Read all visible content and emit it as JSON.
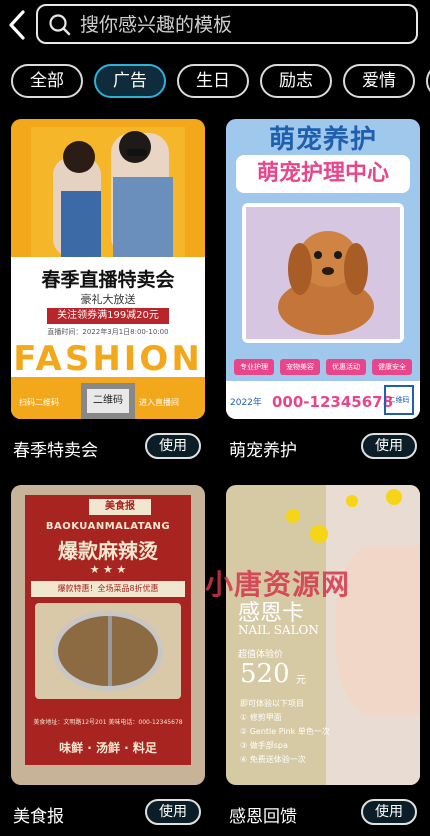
{
  "search": {
    "placeholder": "搜你感兴趣的模板"
  },
  "categories": [
    {
      "label": "全部"
    },
    {
      "label": "广告",
      "active": true
    },
    {
      "label": "生日"
    },
    {
      "label": "励志"
    },
    {
      "label": "爱情"
    }
  ],
  "templates": [
    {
      "title": "春季特卖会",
      "use_label": "使用",
      "poster": {
        "headline": "春季直播特卖会",
        "subline": "豪礼大放送",
        "coupon": "关注领券满199减20元",
        "time": "直播时间：2022年3月1日8:00-10:00",
        "brand": "FASHION",
        "qr_label": "二维码",
        "scan_left": "扫码二维码",
        "scan_right": "进入直播间"
      }
    },
    {
      "title": "萌宠养护",
      "use_label": "使用",
      "poster": {
        "headline": "萌宠养护",
        "subline": "萌宠护理中心",
        "tags": [
          "专业护理",
          "宠物美容",
          "优惠活动",
          "健康安全"
        ],
        "year": "2022年",
        "phone": "000-12345678",
        "qr_label": "二维码"
      }
    },
    {
      "title": "美食报",
      "use_label": "使用",
      "poster": {
        "badge": "美食报",
        "latin": "BAOKUANMALATANG",
        "headline": "爆款麻辣烫",
        "stars": "★ ★ ★",
        "promo": "爆款特惠！全场菜品8折优惠",
        "address": "美食地址：文明路12号201  美味电话：000-12345678",
        "slogan": "味鲜 · 汤鲜 · 料足"
      }
    },
    {
      "title": "感恩回馈",
      "use_label": "使用",
      "poster": {
        "headline": "感恩卡",
        "subline": "NAIL SALON",
        "price_label": "超值体验价",
        "price": "520",
        "price_unit": "元",
        "items": [
          "即可体验以下项目",
          "① 修剪甲面",
          "② Gentle Pink 单色一次",
          "③ 做手部spa",
          "④ 免费送体验一次"
        ]
      }
    }
  ],
  "watermark": "小唐资源网",
  "colors": {
    "chip_active_bg": "#0f2c3c",
    "chip_active_border": "#2fb0d8",
    "background": "#000000"
  }
}
